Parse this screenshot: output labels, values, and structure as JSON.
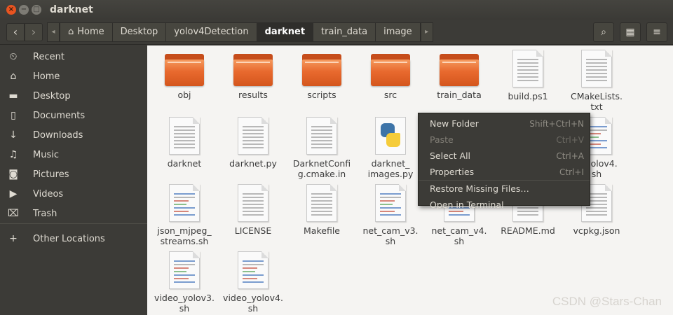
{
  "window": {
    "title": "darknet"
  },
  "controls": {
    "close": "×",
    "minimize": "−",
    "maximize": "□"
  },
  "toolbar": {
    "back": "‹",
    "forward": "›",
    "path_left": "◂",
    "path_right": "▸",
    "search": "⌕",
    "view": "▦",
    "menu": "≡"
  },
  "breadcrumbs": [
    {
      "label": "Home",
      "icon": "home-icon"
    },
    {
      "label": "Desktop"
    },
    {
      "label": "yolov4Detection"
    },
    {
      "label": "darknet",
      "active": true
    },
    {
      "label": "train_data"
    },
    {
      "label": "image"
    }
  ],
  "sidebar": {
    "items": [
      {
        "label": "Recent",
        "icon": "clock-icon",
        "glyph": "⏲"
      },
      {
        "label": "Home",
        "icon": "home-icon",
        "glyph": "⌂"
      },
      {
        "label": "Desktop",
        "icon": "folder-icon",
        "glyph": "▬"
      },
      {
        "label": "Documents",
        "icon": "document-icon",
        "glyph": "▯"
      },
      {
        "label": "Downloads",
        "icon": "download-icon",
        "glyph": "↓"
      },
      {
        "label": "Music",
        "icon": "music-icon",
        "glyph": "♫"
      },
      {
        "label": "Pictures",
        "icon": "camera-icon",
        "glyph": "◙"
      },
      {
        "label": "Videos",
        "icon": "video-icon",
        "glyph": "▶"
      },
      {
        "label": "Trash",
        "icon": "trash-icon",
        "glyph": "⌧"
      },
      {
        "label": "Other Locations",
        "icon": "plus-icon",
        "glyph": "+"
      }
    ]
  },
  "files": [
    {
      "name": "obj",
      "kind": "folder"
    },
    {
      "name": "results",
      "kind": "folder"
    },
    {
      "name": "scripts",
      "kind": "folder"
    },
    {
      "name": "src",
      "kind": "folder"
    },
    {
      "name": "train_data",
      "kind": "folder"
    },
    {
      "name": "build.ps1",
      "kind": "text"
    },
    {
      "name": "CMakeLists.\ntxt",
      "kind": "text"
    },
    {
      "name": "darknet",
      "kind": "text"
    },
    {
      "name": "darknet.py",
      "kind": "text"
    },
    {
      "name": "DarknetConfi\ng.cmake.in",
      "kind": "text"
    },
    {
      "name": "darknet_\nimages.py",
      "kind": "python"
    },
    {
      "name": "",
      "kind": "text"
    },
    {
      "name": "",
      "kind": "text"
    },
    {
      "name": "e_yolov4.\nsh",
      "kind": "code"
    },
    {
      "name": "json_mjpeg_\nstreams.sh",
      "kind": "code"
    },
    {
      "name": "LICENSE",
      "kind": "text"
    },
    {
      "name": "Makefile",
      "kind": "text"
    },
    {
      "name": "net_cam_v3.\nsh",
      "kind": "code"
    },
    {
      "name": "net_cam_v4.\nsh",
      "kind": "code"
    },
    {
      "name": "README.md",
      "kind": "text"
    },
    {
      "name": "vcpkg.json",
      "kind": "text"
    },
    {
      "name": "video_yolov3.\nsh",
      "kind": "code"
    },
    {
      "name": "video_yolov4.\nsh",
      "kind": "code"
    }
  ],
  "context_menu": {
    "items": [
      {
        "label": "New Folder",
        "shortcut": "Shift+Ctrl+N",
        "disabled": false
      },
      {
        "label": "Paste",
        "shortcut": "Ctrl+V",
        "disabled": true
      },
      {
        "label": "Select All",
        "shortcut": "Ctrl+A",
        "disabled": false
      },
      {
        "label": "Properties",
        "shortcut": "Ctrl+I",
        "disabled": false
      },
      {
        "label": "Restore Missing Files…",
        "shortcut": "",
        "disabled": false
      },
      {
        "label": "Open in Terminal",
        "shortcut": "",
        "disabled": false
      }
    ]
  },
  "watermark": "CSDN @Stars-Chan",
  "colors": {
    "accent": "#e95420",
    "sidebar": "#3c3b37",
    "main_bg": "#f5f4f2"
  }
}
